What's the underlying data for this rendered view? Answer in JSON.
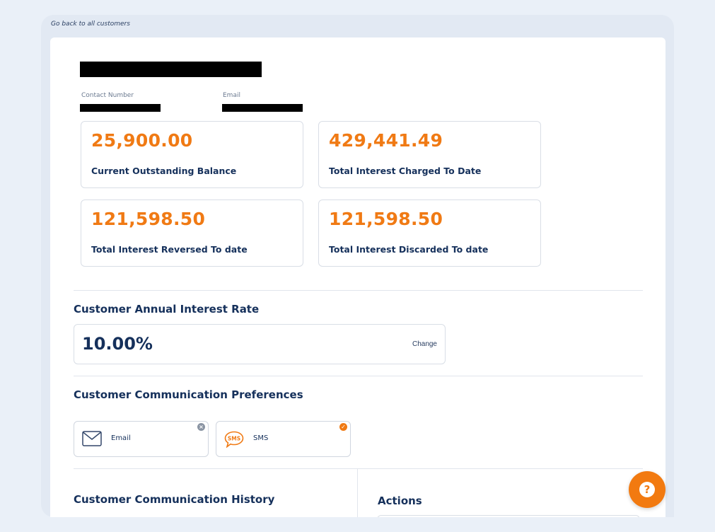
{
  "nav": {
    "back_label": "Go back to all customers"
  },
  "customer": {
    "contact_label": "Contact Number",
    "email_label": "Email"
  },
  "stats": [
    {
      "amount": "25,900.00",
      "label": "Current Outstanding Balance"
    },
    {
      "amount": "429,441.49",
      "label": "Total Interest Charged To Date"
    },
    {
      "amount": "121,598.50",
      "label": "Total Interest Reversed To date"
    },
    {
      "amount": "121,598.50",
      "label": "Total Interest Discarded To date"
    }
  ],
  "interest": {
    "title": "Customer Annual Interest Rate",
    "value": "10.00%",
    "change_label": "Change"
  },
  "preferences": {
    "title": "Customer Communication Preferences",
    "items": [
      {
        "label": "Email",
        "icon": "envelope-icon",
        "selected": false
      },
      {
        "label": "SMS",
        "icon": "sms-bubble-icon",
        "selected": true
      }
    ]
  },
  "history": {
    "title": "Customer Communication History"
  },
  "actions": {
    "title": "Actions"
  },
  "colors": {
    "accent": "#f07a14",
    "navy": "#15305b",
    "background": "#eaf0f8"
  }
}
